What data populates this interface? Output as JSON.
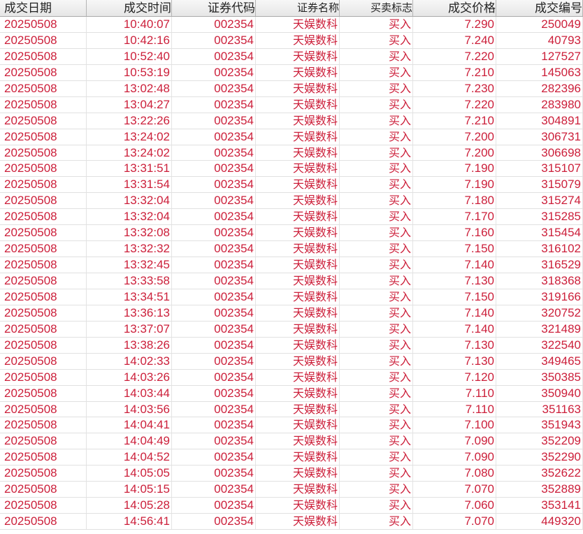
{
  "columns": [
    {
      "key": "date",
      "label": "成交日期"
    },
    {
      "key": "time",
      "label": "成交时间"
    },
    {
      "key": "code",
      "label": "证券代码",
      "sort_icon": "△"
    },
    {
      "key": "name",
      "label": "证券名称"
    },
    {
      "key": "flag",
      "label": "买卖标志"
    },
    {
      "key": "price",
      "label": "成交价格"
    },
    {
      "key": "no",
      "label": "成交编号"
    }
  ],
  "colors": {
    "buy_text": "#cc1f3a"
  },
  "rows": [
    {
      "date": "20250508",
      "time": "10:40:07",
      "code": "002354",
      "name": "天娱数科",
      "flag": "买入",
      "price": "7.290",
      "no": "250049"
    },
    {
      "date": "20250508",
      "time": "10:42:16",
      "code": "002354",
      "name": "天娱数科",
      "flag": "买入",
      "price": "7.240",
      "no": "40793"
    },
    {
      "date": "20250508",
      "time": "10:52:40",
      "code": "002354",
      "name": "天娱数科",
      "flag": "买入",
      "price": "7.220",
      "no": "127527"
    },
    {
      "date": "20250508",
      "time": "10:53:19",
      "code": "002354",
      "name": "天娱数科",
      "flag": "买入",
      "price": "7.210",
      "no": "145063"
    },
    {
      "date": "20250508",
      "time": "13:02:48",
      "code": "002354",
      "name": "天娱数科",
      "flag": "买入",
      "price": "7.230",
      "no": "282396"
    },
    {
      "date": "20250508",
      "time": "13:04:27",
      "code": "002354",
      "name": "天娱数科",
      "flag": "买入",
      "price": "7.220",
      "no": "283980"
    },
    {
      "date": "20250508",
      "time": "13:22:26",
      "code": "002354",
      "name": "天娱数科",
      "flag": "买入",
      "price": "7.210",
      "no": "304891"
    },
    {
      "date": "20250508",
      "time": "13:24:02",
      "code": "002354",
      "name": "天娱数科",
      "flag": "买入",
      "price": "7.200",
      "no": "306731"
    },
    {
      "date": "20250508",
      "time": "13:24:02",
      "code": "002354",
      "name": "天娱数科",
      "flag": "买入",
      "price": "7.200",
      "no": "306698"
    },
    {
      "date": "20250508",
      "time": "13:31:51",
      "code": "002354",
      "name": "天娱数科",
      "flag": "买入",
      "price": "7.190",
      "no": "315107"
    },
    {
      "date": "20250508",
      "time": "13:31:54",
      "code": "002354",
      "name": "天娱数科",
      "flag": "买入",
      "price": "7.190",
      "no": "315079"
    },
    {
      "date": "20250508",
      "time": "13:32:04",
      "code": "002354",
      "name": "天娱数科",
      "flag": "买入",
      "price": "7.180",
      "no": "315274"
    },
    {
      "date": "20250508",
      "time": "13:32:04",
      "code": "002354",
      "name": "天娱数科",
      "flag": "买入",
      "price": "7.170",
      "no": "315285"
    },
    {
      "date": "20250508",
      "time": "13:32:08",
      "code": "002354",
      "name": "天娱数科",
      "flag": "买入",
      "price": "7.160",
      "no": "315454"
    },
    {
      "date": "20250508",
      "time": "13:32:32",
      "code": "002354",
      "name": "天娱数科",
      "flag": "买入",
      "price": "7.150",
      "no": "316102"
    },
    {
      "date": "20250508",
      "time": "13:32:45",
      "code": "002354",
      "name": "天娱数科",
      "flag": "买入",
      "price": "7.140",
      "no": "316529"
    },
    {
      "date": "20250508",
      "time": "13:33:58",
      "code": "002354",
      "name": "天娱数科",
      "flag": "买入",
      "price": "7.130",
      "no": "318368"
    },
    {
      "date": "20250508",
      "time": "13:34:51",
      "code": "002354",
      "name": "天娱数科",
      "flag": "买入",
      "price": "7.150",
      "no": "319166"
    },
    {
      "date": "20250508",
      "time": "13:36:13",
      "code": "002354",
      "name": "天娱数科",
      "flag": "买入",
      "price": "7.140",
      "no": "320752"
    },
    {
      "date": "20250508",
      "time": "13:37:07",
      "code": "002354",
      "name": "天娱数科",
      "flag": "买入",
      "price": "7.140",
      "no": "321489"
    },
    {
      "date": "20250508",
      "time": "13:38:26",
      "code": "002354",
      "name": "天娱数科",
      "flag": "买入",
      "price": "7.130",
      "no": "322540"
    },
    {
      "date": "20250508",
      "time": "14:02:33",
      "code": "002354",
      "name": "天娱数科",
      "flag": "买入",
      "price": "7.130",
      "no": "349465"
    },
    {
      "date": "20250508",
      "time": "14:03:26",
      "code": "002354",
      "name": "天娱数科",
      "flag": "买入",
      "price": "7.120",
      "no": "350385"
    },
    {
      "date": "20250508",
      "time": "14:03:44",
      "code": "002354",
      "name": "天娱数科",
      "flag": "买入",
      "price": "7.110",
      "no": "350940"
    },
    {
      "date": "20250508",
      "time": "14:03:56",
      "code": "002354",
      "name": "天娱数科",
      "flag": "买入",
      "price": "7.110",
      "no": "351163"
    },
    {
      "date": "20250508",
      "time": "14:04:41",
      "code": "002354",
      "name": "天娱数科",
      "flag": "买入",
      "price": "7.100",
      "no": "351943"
    },
    {
      "date": "20250508",
      "time": "14:04:49",
      "code": "002354",
      "name": "天娱数科",
      "flag": "买入",
      "price": "7.090",
      "no": "352209"
    },
    {
      "date": "20250508",
      "time": "14:04:52",
      "code": "002354",
      "name": "天娱数科",
      "flag": "买入",
      "price": "7.090",
      "no": "352290"
    },
    {
      "date": "20250508",
      "time": "14:05:05",
      "code": "002354",
      "name": "天娱数科",
      "flag": "买入",
      "price": "7.080",
      "no": "352622"
    },
    {
      "date": "20250508",
      "time": "14:05:15",
      "code": "002354",
      "name": "天娱数科",
      "flag": "买入",
      "price": "7.070",
      "no": "352889"
    },
    {
      "date": "20250508",
      "time": "14:05:28",
      "code": "002354",
      "name": "天娱数科",
      "flag": "买入",
      "price": "7.060",
      "no": "353141"
    },
    {
      "date": "20250508",
      "time": "14:56:41",
      "code": "002354",
      "name": "天娱数科",
      "flag": "买入",
      "price": "7.070",
      "no": "449320"
    }
  ]
}
